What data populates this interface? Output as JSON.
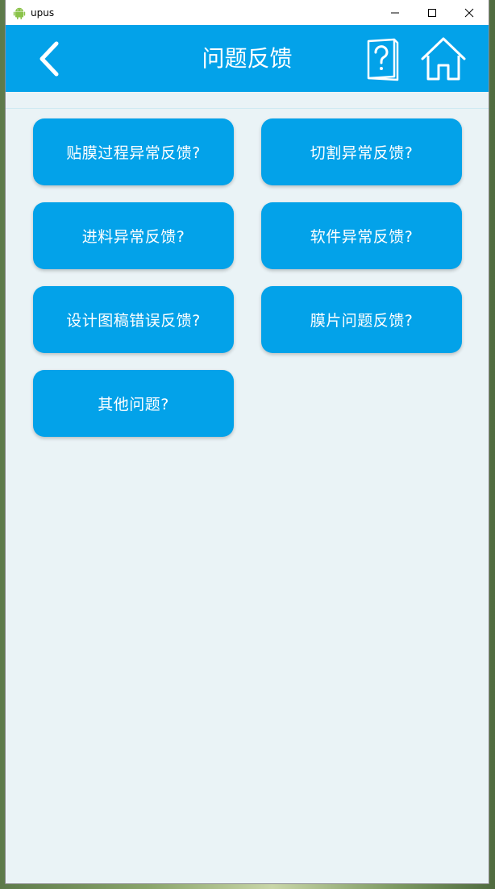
{
  "window": {
    "title": "upus"
  },
  "header": {
    "title": "问题反馈"
  },
  "buttons": [
    {
      "label": "贴膜过程异常反馈?"
    },
    {
      "label": "切割异常反馈?"
    },
    {
      "label": "进料异常反馈?"
    },
    {
      "label": "软件异常反馈?"
    },
    {
      "label": "设计图稿错误反馈?"
    },
    {
      "label": "膜片问题反馈?"
    },
    {
      "label": "其他问题?"
    }
  ],
  "colors": {
    "accent": "#03a2e9",
    "background": "#eaf3f6",
    "button_text": "#ffffff"
  },
  "icons": {
    "app": "android-icon",
    "back": "chevron-left-icon",
    "help": "question-book-icon",
    "home": "home-icon"
  }
}
